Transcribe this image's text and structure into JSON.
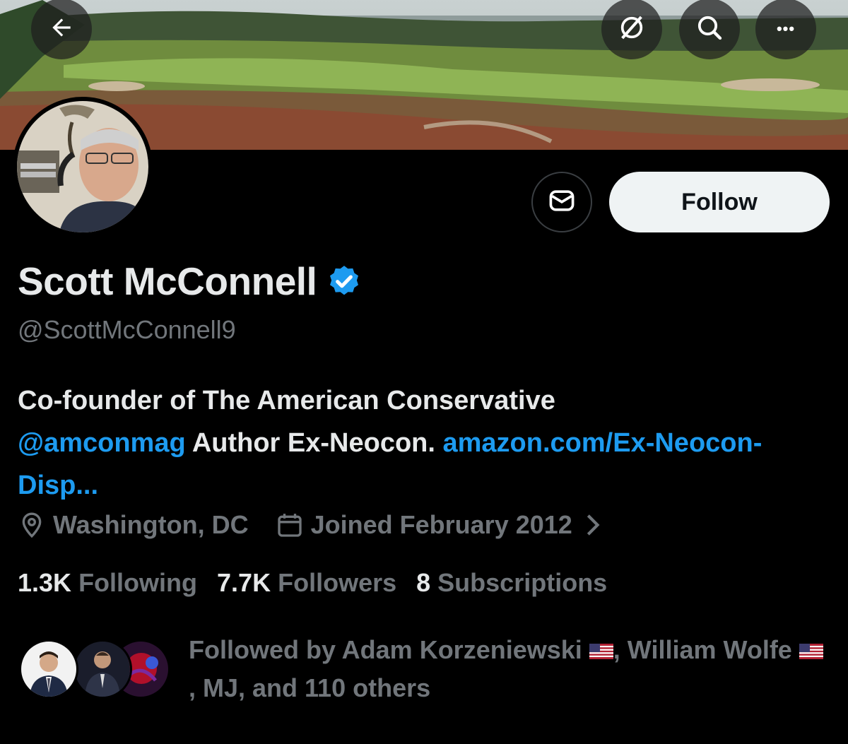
{
  "header": {
    "back_icon": "arrow-left-icon",
    "grok_icon": "grok-icon",
    "search_icon": "search-icon",
    "more_icon": "more-horizontal-icon",
    "more_glyph": "•••"
  },
  "profile": {
    "name": "Scott McConnell",
    "verified": true,
    "handle": "@ScottMcConnell9",
    "follow_label": "Follow",
    "bio": {
      "text1": "Co-founder of The American Conservative",
      "mention": "@amconmag",
      "text2": " Author Ex-Neocon. ",
      "link": "amazon.com/Ex-Neocon-Disp..."
    },
    "location": "Washington, DC",
    "joined": "Joined February 2012",
    "stats": {
      "following_count": "1.3K",
      "following_label": "Following",
      "followers_count": "7.7K",
      "followers_label": "Followers",
      "subscriptions_count": "8",
      "subscriptions_label": "Subscriptions"
    },
    "followed_by": {
      "prefix": "Followed by ",
      "name1": "Adam Korzeniewski",
      "sep1": ", ",
      "name2": "William Wolfe",
      "suffix": ", MJ, and 110 others"
    }
  },
  "colors": {
    "accent": "#1d9bf0",
    "background": "#000000",
    "muted": "#71767b",
    "text": "#e7e9ea"
  }
}
